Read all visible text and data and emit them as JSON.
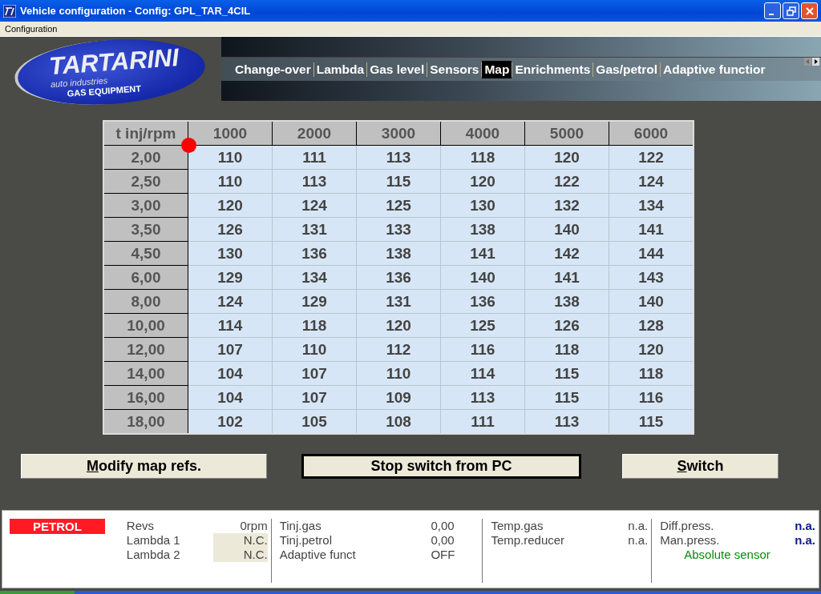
{
  "window": {
    "title": "Vehicle configuration - Config: GPL_TAR_4CIL"
  },
  "menu": [
    "Configuration"
  ],
  "logo": {
    "brand": "TARTARINI",
    "subtitle": "auto industries",
    "tagline": "GAS EQUIPMENT"
  },
  "tabs": [
    {
      "label": "Change-over",
      "selected": false
    },
    {
      "label": "Lambda",
      "selected": false
    },
    {
      "label": "Gas level",
      "selected": false
    },
    {
      "label": "Sensors",
      "selected": false
    },
    {
      "label": "Map",
      "selected": true
    },
    {
      "label": "Enrichments",
      "selected": false
    },
    {
      "label": "Gas/petrol",
      "selected": false
    },
    {
      "label": "Adaptive functior",
      "selected": false
    }
  ],
  "map_table": {
    "corner": "t inj/rpm",
    "columns": [
      "1000",
      "2000",
      "3000",
      "4000",
      "5000",
      "6000"
    ],
    "rows": [
      {
        "label": "2,00",
        "cells": [
          "110",
          "111",
          "113",
          "118",
          "120",
          "122"
        ]
      },
      {
        "label": "2,50",
        "cells": [
          "110",
          "113",
          "115",
          "120",
          "122",
          "124"
        ]
      },
      {
        "label": "3,00",
        "cells": [
          "120",
          "124",
          "125",
          "130",
          "132",
          "134"
        ]
      },
      {
        "label": "3,50",
        "cells": [
          "126",
          "131",
          "133",
          "138",
          "140",
          "141"
        ]
      },
      {
        "label": "4,50",
        "cells": [
          "130",
          "136",
          "138",
          "141",
          "142",
          "144"
        ]
      },
      {
        "label": "6,00",
        "cells": [
          "129",
          "134",
          "136",
          "140",
          "141",
          "143"
        ]
      },
      {
        "label": "8,00",
        "cells": [
          "124",
          "129",
          "131",
          "136",
          "138",
          "140"
        ]
      },
      {
        "label": "10,00",
        "cells": [
          "114",
          "118",
          "120",
          "125",
          "126",
          "128"
        ]
      },
      {
        "label": "12,00",
        "cells": [
          "107",
          "110",
          "112",
          "116",
          "118",
          "120"
        ]
      },
      {
        "label": "14,00",
        "cells": [
          "104",
          "107",
          "110",
          "114",
          "115",
          "118"
        ]
      },
      {
        "label": "16,00",
        "cells": [
          "104",
          "107",
          "109",
          "113",
          "115",
          "116"
        ]
      },
      {
        "label": "18,00",
        "cells": [
          "102",
          "105",
          "108",
          "111",
          "113",
          "115"
        ]
      }
    ]
  },
  "buttons": [
    {
      "label": "Modify map refs.",
      "focused": false,
      "mnemonic_underlined": true
    },
    {
      "label": "Stop switch from PC",
      "focused": true,
      "mnemonic_underlined": false
    },
    {
      "label": "Switch",
      "focused": false,
      "mnemonic_underlined": true
    }
  ],
  "status_panel": {
    "fuel_mode": "PETROL",
    "sections": [
      [
        {
          "label": "Revs",
          "value": "0rpm",
          "kind": "plain"
        },
        {
          "label": "Lambda 1",
          "value": "N.C.",
          "kind": "shaded"
        },
        {
          "label": "Lambda 2",
          "value": "N.C.",
          "kind": "shaded"
        }
      ],
      [
        {
          "label": "Tinj.gas",
          "value": "0,00",
          "kind": "left"
        },
        {
          "label": "Tinj.petrol",
          "value": "0,00",
          "kind": "left"
        },
        {
          "label": "Adaptive funct",
          "value": "OFF",
          "kind": "left"
        }
      ],
      [
        {
          "label": "Temp.gas",
          "value": "n.a.",
          "kind": "plain"
        },
        {
          "label": "Temp.reducer",
          "value": "n.a.",
          "kind": "plain"
        }
      ],
      [
        {
          "label": "Diff.press.",
          "value": "n.a.",
          "kind": "accent"
        },
        {
          "label": "Man.press.",
          "value": "n.a.",
          "kind": "accent"
        }
      ]
    ],
    "sensor_note": "Absolute sensor"
  }
}
